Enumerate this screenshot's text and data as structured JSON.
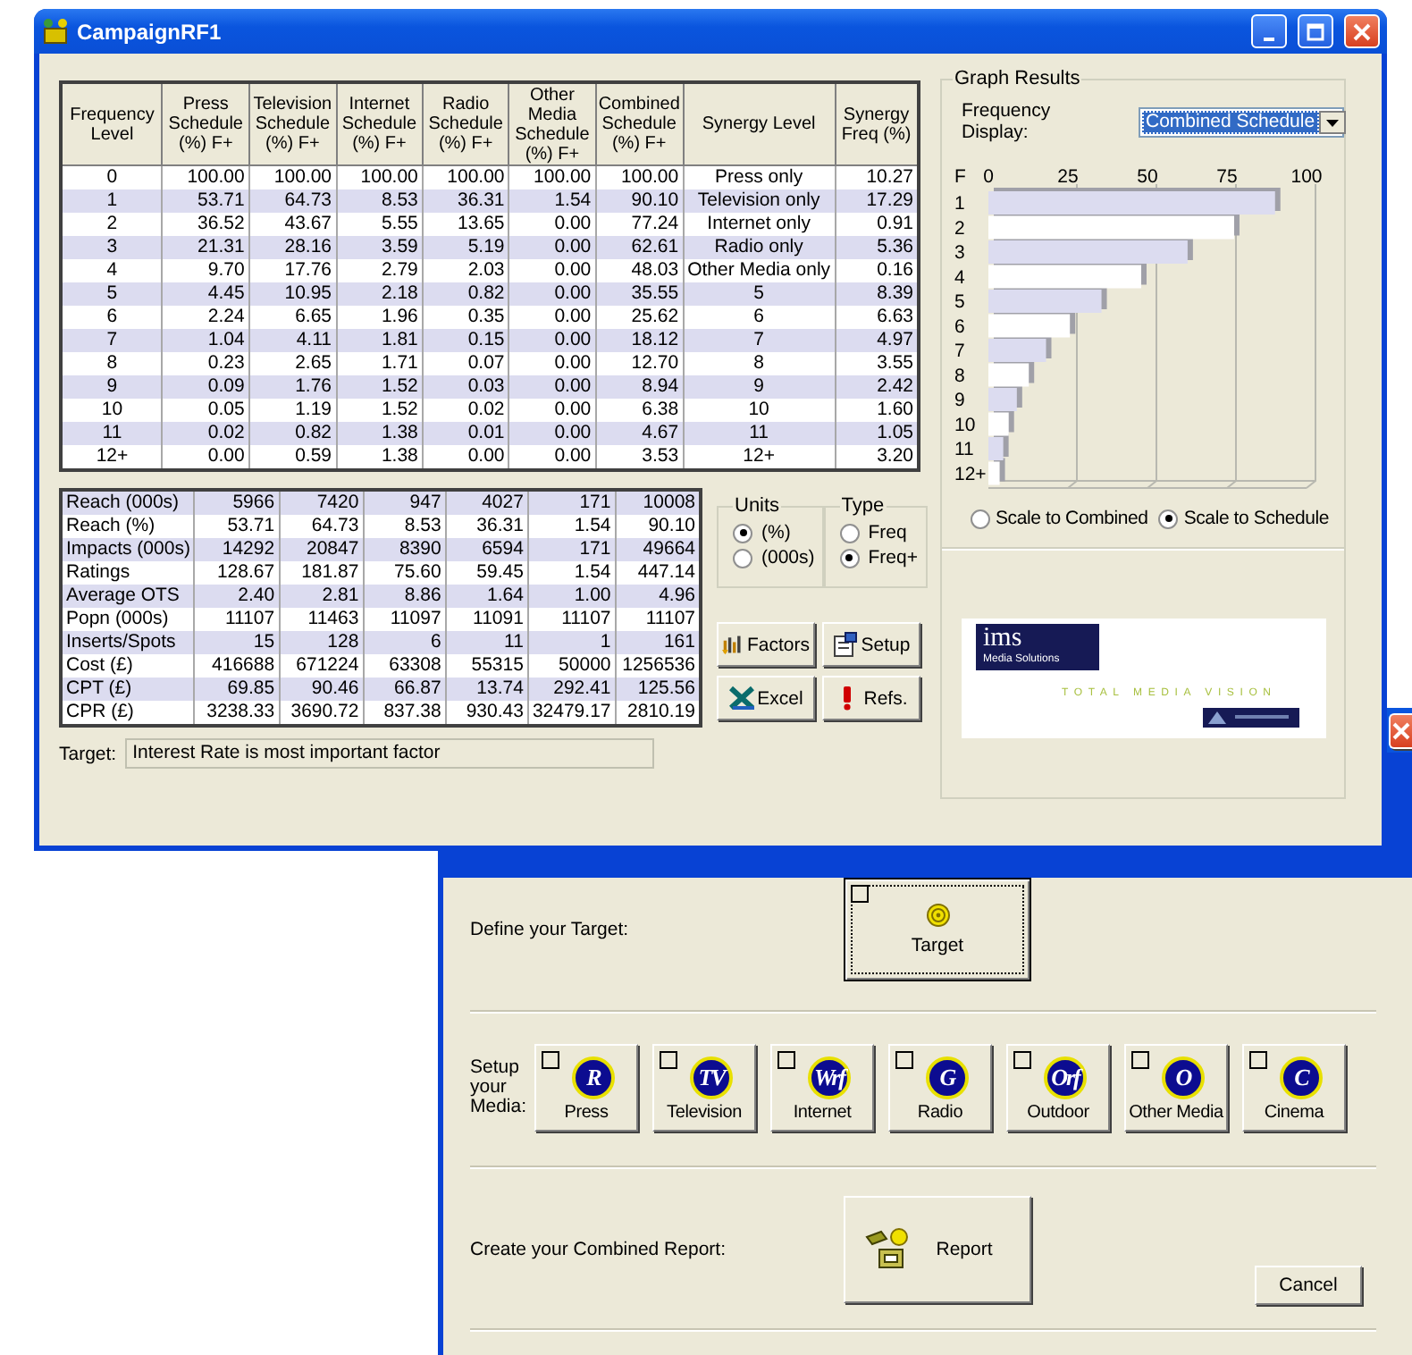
{
  "window": {
    "title": "CampaignRF1"
  },
  "frequency_table": {
    "columns": [
      "Frequency Level",
      "Press Schedule (%) F+",
      "Television Schedule (%) F+",
      "Internet Schedule (%) F+",
      "Radio Schedule (%) F+",
      "Other Media Schedule (%) F+",
      "Combined Schedule (%) F+",
      "Synergy   Level",
      "Synergy Freq (%)"
    ],
    "rows": [
      [
        "0",
        "100.00",
        "100.00",
        "100.00",
        "100.00",
        "100.00",
        "100.00",
        "Press only",
        "10.27"
      ],
      [
        "1",
        "53.71",
        "64.73",
        "8.53",
        "36.31",
        "1.54",
        "90.10",
        "Television only",
        "17.29"
      ],
      [
        "2",
        "36.52",
        "43.67",
        "5.55",
        "13.65",
        "0.00",
        "77.24",
        "Internet only",
        "0.91"
      ],
      [
        "3",
        "21.31",
        "28.16",
        "3.59",
        "5.19",
        "0.00",
        "62.61",
        "Radio only",
        "5.36"
      ],
      [
        "4",
        "9.70",
        "17.76",
        "2.79",
        "2.03",
        "0.00",
        "48.03",
        "Other Media only",
        "0.16"
      ],
      [
        "5",
        "4.45",
        "10.95",
        "2.18",
        "0.82",
        "0.00",
        "35.55",
        "5",
        "8.39"
      ],
      [
        "6",
        "2.24",
        "6.65",
        "1.96",
        "0.35",
        "0.00",
        "25.62",
        "6",
        "6.63"
      ],
      [
        "7",
        "1.04",
        "4.11",
        "1.81",
        "0.15",
        "0.00",
        "18.12",
        "7",
        "4.97"
      ],
      [
        "8",
        "0.23",
        "2.65",
        "1.71",
        "0.07",
        "0.00",
        "12.70",
        "8",
        "3.55"
      ],
      [
        "9",
        "0.09",
        "1.76",
        "1.52",
        "0.03",
        "0.00",
        "8.94",
        "9",
        "2.42"
      ],
      [
        "10",
        "0.05",
        "1.19",
        "1.52",
        "0.02",
        "0.00",
        "6.38",
        "10",
        "1.60"
      ],
      [
        "11",
        "0.02",
        "0.82",
        "1.38",
        "0.01",
        "0.00",
        "4.67",
        "11",
        "1.05"
      ],
      [
        "12+",
        "0.00",
        "0.59",
        "1.38",
        "0.00",
        "0.00",
        "3.53",
        "12+",
        "3.20"
      ]
    ]
  },
  "summary_table": {
    "rows": [
      [
        "Reach (000s)",
        "5966",
        "7420",
        "947",
        "4027",
        "171",
        "10008"
      ],
      [
        "Reach (%)",
        "53.71",
        "64.73",
        "8.53",
        "36.31",
        "1.54",
        "90.10"
      ],
      [
        "Impacts (000s)",
        "14292",
        "20847",
        "8390",
        "6594",
        "171",
        "49664"
      ],
      [
        "Ratings",
        "128.67",
        "181.87",
        "75.60",
        "59.45",
        "1.54",
        "447.14"
      ],
      [
        "Average OTS",
        "2.40",
        "2.81",
        "8.86",
        "1.64",
        "1.00",
        "4.96"
      ],
      [
        "Popn (000s)",
        "11107",
        "11463",
        "11097",
        "11091",
        "11107",
        "11107"
      ],
      [
        "Inserts/Spots",
        "15",
        "128",
        "6",
        "11",
        "1",
        "161"
      ],
      [
        "Cost (£)",
        "416688",
        "671224",
        "63308",
        "55315",
        "50000",
        "1256536"
      ],
      [
        "CPT (£)",
        "69.85",
        "90.46",
        "66.87",
        "13.74",
        "292.41",
        "125.56"
      ],
      [
        "CPR (£)",
        "3238.33",
        "3690.72",
        "837.38",
        "930.43",
        "32479.17",
        "2810.19"
      ]
    ]
  },
  "target": {
    "label": "Target:",
    "value": "Interest Rate is most important factor"
  },
  "option_groups": [
    {
      "title": "Units",
      "options": [
        {
          "label": "(%)",
          "selected": true
        },
        {
          "label": "(000s)",
          "selected": false
        }
      ]
    },
    {
      "title": "Type",
      "options": [
        {
          "label": "Freq",
          "selected": false
        },
        {
          "label": "Freq+",
          "selected": true
        }
      ]
    }
  ],
  "buttons": [
    {
      "label": "Factors",
      "kind": "factors"
    },
    {
      "label": "Setup",
      "kind": "setup"
    },
    {
      "label": "Excel",
      "kind": "excel"
    },
    {
      "label": "Refs.",
      "kind": "refs"
    }
  ],
  "graph": {
    "title": "Graph Results",
    "display_label": "Frequency Display:",
    "display_value": "Combined Schedule",
    "chart_data": {
      "type": "bar",
      "orientation": "horizontal",
      "ylabel": "F",
      "categories": [
        "1",
        "2",
        "3",
        "4",
        "5",
        "6",
        "7",
        "8",
        "9",
        "10",
        "11",
        "12+"
      ],
      "values": [
        90.1,
        77.24,
        62.61,
        48.03,
        35.55,
        25.62,
        18.12,
        12.7,
        8.94,
        6.38,
        4.67,
        3.53
      ],
      "xlim": [
        0,
        100
      ],
      "xticks": [
        0,
        25,
        50,
        75,
        100
      ]
    },
    "scale_options": [
      {
        "label": "Scale to Combined",
        "selected": false
      },
      {
        "label": "Scale to Schedule",
        "selected": true
      }
    ]
  },
  "logo": {
    "name": "ims",
    "subtitle": "Media Solutions",
    "tagline": "TOTAL MEDIA VISION"
  },
  "media_window": {
    "target_prompt": "Define your Target:",
    "target_button": {
      "label": "Target",
      "checked": false
    },
    "media_prompt": "Setup your Media:",
    "media": [
      {
        "label": "Press",
        "glyph": "R",
        "checked": false
      },
      {
        "label": "Television",
        "glyph": "TV",
        "checked": false
      },
      {
        "label": "Internet",
        "glyph": "Wrf",
        "checked": false
      },
      {
        "label": "Radio",
        "glyph": "G",
        "checked": false
      },
      {
        "label": "Outdoor",
        "glyph": "Orf",
        "checked": false
      },
      {
        "label": "Other Media",
        "glyph": "O",
        "checked": false
      },
      {
        "label": "Cinema",
        "glyph": "C",
        "checked": false
      }
    ],
    "report_prompt": "Create your Combined Report:",
    "report_button": "Report",
    "cancel_button": "Cancel"
  }
}
